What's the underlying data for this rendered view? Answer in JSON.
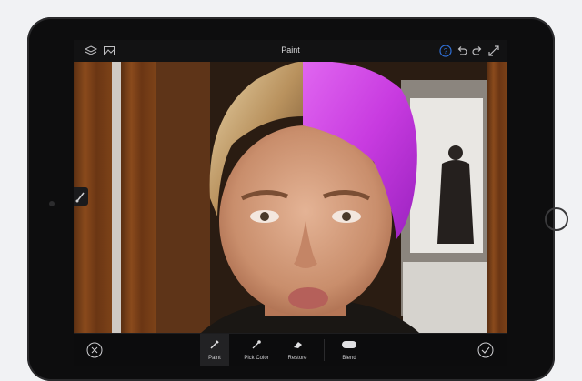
{
  "toolbar": {
    "title": "Paint"
  },
  "tools": [
    {
      "label": "Paint",
      "icon": "paint-brush-icon",
      "active": true
    },
    {
      "label": "Pick Color",
      "icon": "eyedropper-icon",
      "active": false
    },
    {
      "label": "Restore",
      "icon": "eraser-icon",
      "active": false
    },
    {
      "label": "Blend",
      "icon": "blend-toggle-icon",
      "active": false
    }
  ],
  "colors": {
    "paint_color": "#c83be0",
    "toolbar_accent": "#2f6fd6",
    "device": "#0d0d0e"
  }
}
